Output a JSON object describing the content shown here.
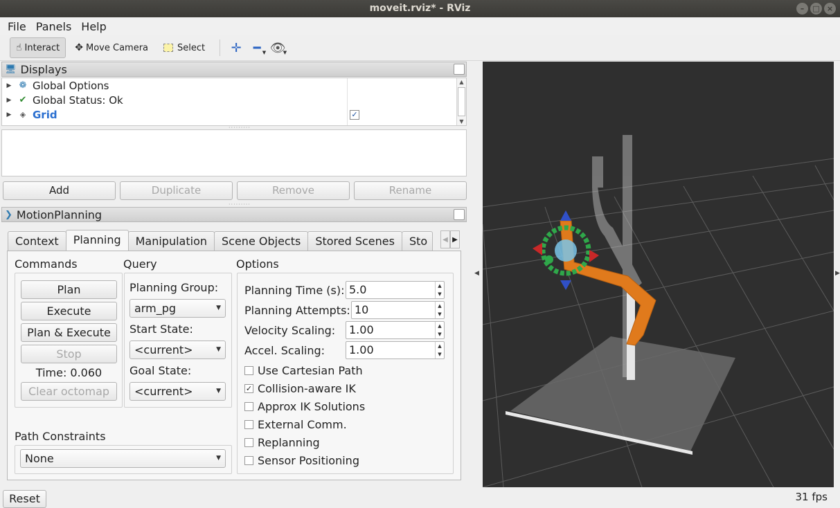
{
  "window": {
    "title": "moveit.rviz* - RViz"
  },
  "menu": [
    "File",
    "Panels",
    "Help"
  ],
  "toolbar": {
    "interact": "Interact",
    "move_camera": "Move Camera",
    "select": "Select"
  },
  "displays": {
    "title": "Displays",
    "items": [
      {
        "label": "Global Options",
        "icon": "gear-icon"
      },
      {
        "label": "Global Status: Ok",
        "icon": "check-icon"
      },
      {
        "label": "Grid",
        "icon": "grid-icon",
        "checked": true
      }
    ],
    "buttons": {
      "add": "Add",
      "duplicate": "Duplicate",
      "remove": "Remove",
      "rename": "Rename"
    }
  },
  "motion_planning": {
    "title": "MotionPlanning",
    "tabs": [
      "Context",
      "Planning",
      "Manipulation",
      "Scene Objects",
      "Stored Scenes",
      "Sto"
    ],
    "active_tab": "Planning",
    "commands": {
      "title": "Commands",
      "plan": "Plan",
      "execute": "Execute",
      "plan_execute": "Plan & Execute",
      "stop": "Stop",
      "time": "Time: 0.060",
      "clear_octomap": "Clear octomap"
    },
    "query": {
      "title": "Query",
      "planning_group_label": "Planning Group:",
      "planning_group": "arm_pg",
      "start_state_label": "Start State:",
      "start_state": "<current>",
      "goal_state_label": "Goal State:",
      "goal_state": "<current>"
    },
    "options": {
      "title": "Options",
      "planning_time_label": "Planning Time (s):",
      "planning_time": "5.0",
      "planning_attempts_label": "Planning Attempts:",
      "planning_attempts": "10",
      "velocity_scaling_label": "Velocity Scaling:",
      "velocity_scaling": "1.00",
      "accel_scaling_label": "Accel. Scaling:",
      "accel_scaling": "1.00",
      "checkboxes": [
        {
          "label": "Use Cartesian Path",
          "checked": false
        },
        {
          "label": "Collision-aware IK",
          "checked": true
        },
        {
          "label": "Approx IK Solutions",
          "checked": false
        },
        {
          "label": "External Comm.",
          "checked": false
        },
        {
          "label": "Replanning",
          "checked": false
        },
        {
          "label": "Sensor Positioning",
          "checked": false
        }
      ]
    },
    "path_constraints": {
      "title": "Path Constraints",
      "value": "None"
    }
  },
  "footer": {
    "reset": "Reset",
    "fps": "31 fps"
  },
  "colors": {
    "link_orange": "#e07a1c",
    "viewport_bg": "#2f2f2f",
    "grid_line": "#5a5a5a"
  }
}
